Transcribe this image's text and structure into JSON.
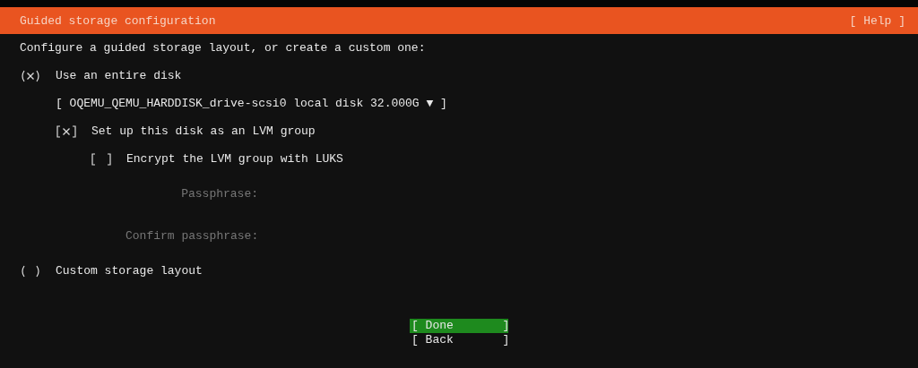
{
  "header": {
    "title": "Guided storage configuration",
    "help": "[ Help ]"
  },
  "intro": "Configure a guided storage layout, or create a custom one:",
  "options": [
    {
      "label": "Use an entire disk",
      "selected": true,
      "disk": "[ OQEMU_QEMU_HARDDISK_drive-scsi0 local disk 32.000G ▼ ]",
      "lvm": {
        "label": "Set up this disk as an LVM group",
        "checked": true
      },
      "encrypt": {
        "label": "Encrypt the LVM group with LUKS",
        "checked": false
      },
      "fields": [
        {
          "label": "Passphrase:"
        },
        {
          "label": "Confirm passphrase:"
        }
      ]
    },
    {
      "label": "Custom storage layout",
      "selected": false
    }
  ],
  "buttons": [
    {
      "label": "[ Done       ]",
      "selected": true
    },
    {
      "label": "[ Back       ]",
      "selected": false
    }
  ]
}
